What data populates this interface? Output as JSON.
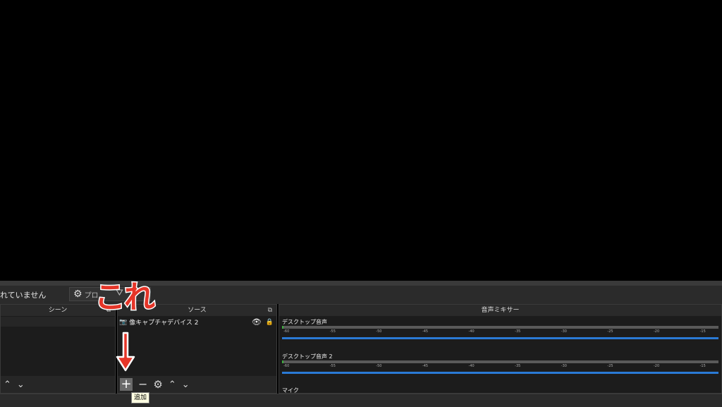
{
  "source_bar": {
    "no_source_text": "れていません",
    "properties_label": "プロ",
    "gear_icon": "gear-icon",
    "filters_icon": "filter-icon"
  },
  "scenes": {
    "header": "シーン",
    "up_icon": "chevron-up-icon",
    "down_icon": "chevron-down-icon"
  },
  "sources": {
    "header": "ソース",
    "items": [
      {
        "name": "像キャプチャデバイス 2",
        "icon": "camera-icon"
      }
    ],
    "toolbar": {
      "add": "+",
      "remove": "−",
      "settings": "gear-icon",
      "up": "chevron-up-icon",
      "down": "chevron-down-icon"
    }
  },
  "mixer": {
    "header": "音声ミキサー",
    "tracks": [
      {
        "name": "デスクトップ音声"
      },
      {
        "name": "デスクトップ音声 2"
      },
      {
        "name": "マイク"
      }
    ],
    "ticks": [
      "-60",
      "-55",
      "-50",
      "-45",
      "-40",
      "-35",
      "-30",
      "-25",
      "-20",
      "-15"
    ]
  },
  "tooltip": "追加",
  "annotation": {
    "text": "これ",
    "color": "#e53528"
  },
  "colors": {
    "accent_volume": "#2a7ad5",
    "add_button": "#6a6a6a"
  }
}
